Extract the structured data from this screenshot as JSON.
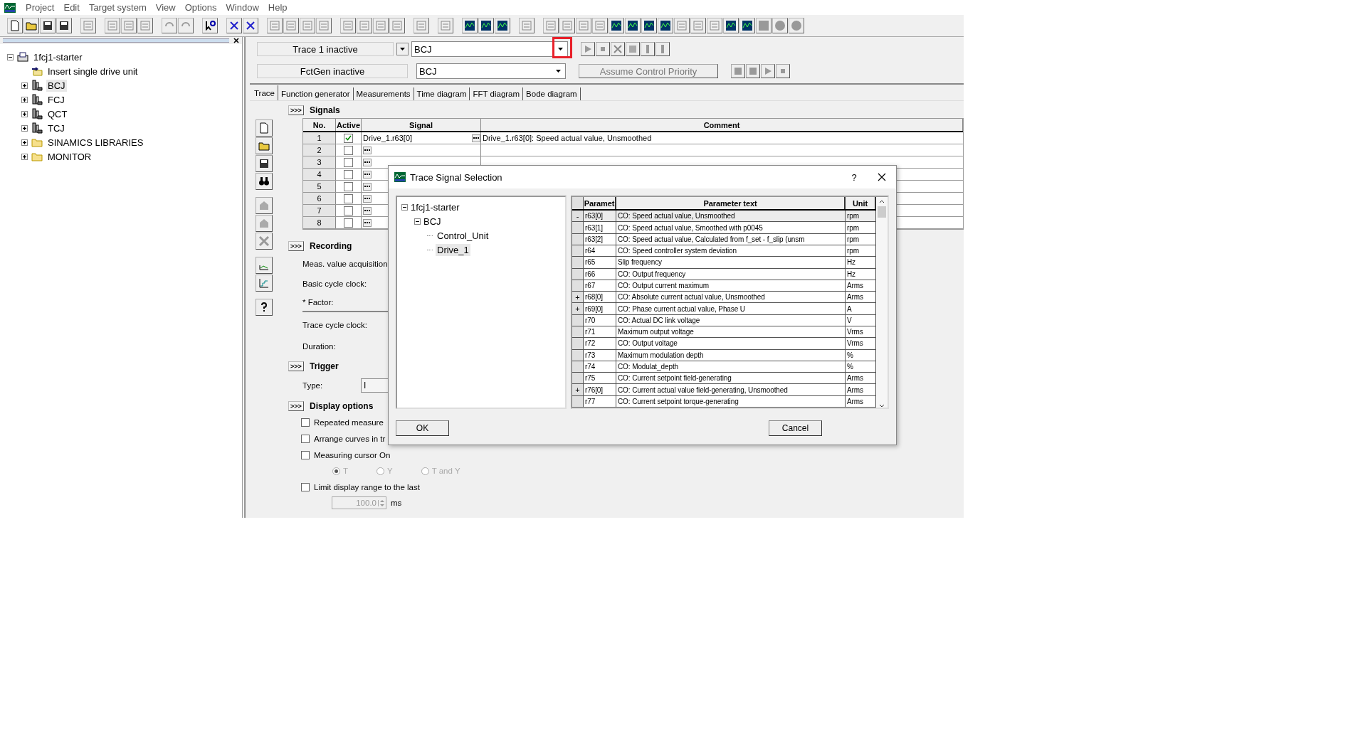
{
  "menu": [
    "Project",
    "Edit",
    "Target system",
    "View",
    "Options",
    "Window",
    "Help"
  ],
  "project_tree": {
    "label": "1fcj1-starter",
    "expanded": true,
    "children": [
      {
        "label": "Insert single drive unit",
        "kind": "action",
        "selected": false
      },
      {
        "label": "BCJ",
        "kind": "drive",
        "expanded": false,
        "selected": true
      },
      {
        "label": "FCJ",
        "kind": "drive",
        "expanded": false,
        "selected": false
      },
      {
        "label": "QCT",
        "kind": "drive",
        "expanded": false,
        "selected": false
      },
      {
        "label": "TCJ",
        "kind": "drive",
        "expanded": false,
        "selected": false
      },
      {
        "label": "SINAMICS LIBRARIES",
        "kind": "folder",
        "expanded": false,
        "selected": false
      },
      {
        "label": "MONITOR",
        "kind": "folder",
        "expanded": false,
        "selected": false
      }
    ]
  },
  "trace_controls": {
    "trace_status": "Trace 1 inactive",
    "trace_device": "BCJ",
    "trace_device_highlighted": true,
    "fctgen_status": "FctGen  inactive",
    "fctgen_device": "BCJ",
    "priority_button": "Assume Control Priority"
  },
  "tabs": [
    {
      "label": "Trace",
      "selected": true
    },
    {
      "label": "Function generator",
      "selected": false
    },
    {
      "label": "Measurements",
      "selected": false
    },
    {
      "label": "Time diagram",
      "selected": false
    },
    {
      "label": "FFT diagram",
      "selected": false
    },
    {
      "label": "Bode diagram",
      "selected": false
    }
  ],
  "signals": {
    "toggle": ">>>",
    "title": "Signals",
    "columns": [
      "No.",
      "Active",
      "Signal",
      "Comment"
    ],
    "rows": [
      {
        "no": "1",
        "active": true,
        "signal": "Drive_1.r63[0]",
        "comment": "Drive_1.r63[0]: Speed actual value, Unsmoothed"
      },
      {
        "no": "2",
        "active": false
      },
      {
        "no": "3",
        "active": false
      },
      {
        "no": "4",
        "active": false
      },
      {
        "no": "5",
        "active": false
      },
      {
        "no": "6",
        "active": false
      },
      {
        "no": "7",
        "active": false
      },
      {
        "no": "8",
        "active": false
      }
    ]
  },
  "recording": {
    "toggle": ">>>",
    "title": "Recording",
    "fields": [
      "Meas. value acquisition",
      "Basic cycle clock:",
      "* Factor:",
      "Trace cycle clock:",
      "Duration:"
    ]
  },
  "trigger": {
    "toggle": ">>>",
    "title": "Trigger",
    "type_label": "Type:",
    "type_value": "I"
  },
  "display_options": {
    "toggle": ">>>",
    "title": "Display options",
    "checkboxes": [
      {
        "label": "Repeated measure",
        "checked": false
      },
      {
        "label": "Arrange curves in tr",
        "checked": false
      },
      {
        "label": "Measuring cursor On",
        "checked": false
      }
    ],
    "cursor_modes_disabled": true,
    "cursor_modes": [
      {
        "label": "T",
        "selected": true
      },
      {
        "label": "Y",
        "selected": false
      },
      {
        "label": "T and Y",
        "selected": false
      }
    ],
    "limit": {
      "label": "Limit display range to the last",
      "checked": false,
      "value": "100.0",
      "unit": "ms"
    }
  },
  "dialog": {
    "title": "Trace Signal Selection",
    "help": "?",
    "tree": {
      "label": "1fcj1-starter",
      "expanded": true,
      "children": [
        {
          "label": "BCJ",
          "expanded": true,
          "children": [
            {
              "label": "Control_Unit",
              "selected": false
            },
            {
              "label": "Drive_1",
              "selected": true
            }
          ]
        }
      ]
    },
    "columns": [
      "Paramet",
      "Parameter text",
      "Unit"
    ],
    "rows": [
      {
        "marker": "-",
        "param": "r63[0]",
        "text": "CO: Speed actual value, Unsmoothed",
        "unit": "rpm",
        "selected": true
      },
      {
        "param": "r63[1]",
        "text": "CO: Speed actual value, Smoothed with p0045",
        "unit": "rpm",
        "selected": false
      },
      {
        "param": "r63[2]",
        "text": "CO: Speed actual value, Calculated from f_set - f_slip (unsm",
        "unit": "rpm",
        "selected": false
      },
      {
        "param": "r64",
        "text": "CO: Speed controller system deviation",
        "unit": "rpm",
        "selected": false
      },
      {
        "param": "r65",
        "text": "Slip frequency",
        "unit": "Hz",
        "selected": false
      },
      {
        "param": "r66",
        "text": "CO: Output frequency",
        "unit": "Hz",
        "selected": false
      },
      {
        "param": "r67",
        "text": "CO: Output current maximum",
        "unit": "Arms",
        "selected": false
      },
      {
        "marker": "+",
        "param": "r68[0]",
        "text": "CO: Absolute current actual value, Unsmoothed",
        "unit": "Arms",
        "selected": false
      },
      {
        "marker": "+",
        "param": "r69[0]",
        "text": "CO: Phase current actual value, Phase U",
        "unit": "A",
        "selected": false
      },
      {
        "param": "r70",
        "text": "CO: Actual DC link voltage",
        "unit": "V",
        "selected": false
      },
      {
        "param": "r71",
        "text": "Maximum output voltage",
        "unit": "Vrms",
        "selected": false
      },
      {
        "param": "r72",
        "text": "CO: Output voltage",
        "unit": "Vrms",
        "selected": false
      },
      {
        "param": "r73",
        "text": "Maximum modulation depth",
        "unit": "%",
        "selected": false
      },
      {
        "param": "r74",
        "text": "CO: Modulat_depth",
        "unit": "%",
        "selected": false
      },
      {
        "param": "r75",
        "text": "CO: Current setpoint field-generating",
        "unit": "Arms",
        "selected": false
      },
      {
        "marker": "+",
        "param": "r76[0]",
        "text": "CO: Current actual value field-generating, Unsmoothed",
        "unit": "Arms",
        "selected": false
      },
      {
        "param": "r77",
        "text": "CO: Current setpoint torque-generating",
        "unit": "Arms",
        "selected": false
      }
    ],
    "ok": "OK",
    "cancel": "Cancel"
  }
}
